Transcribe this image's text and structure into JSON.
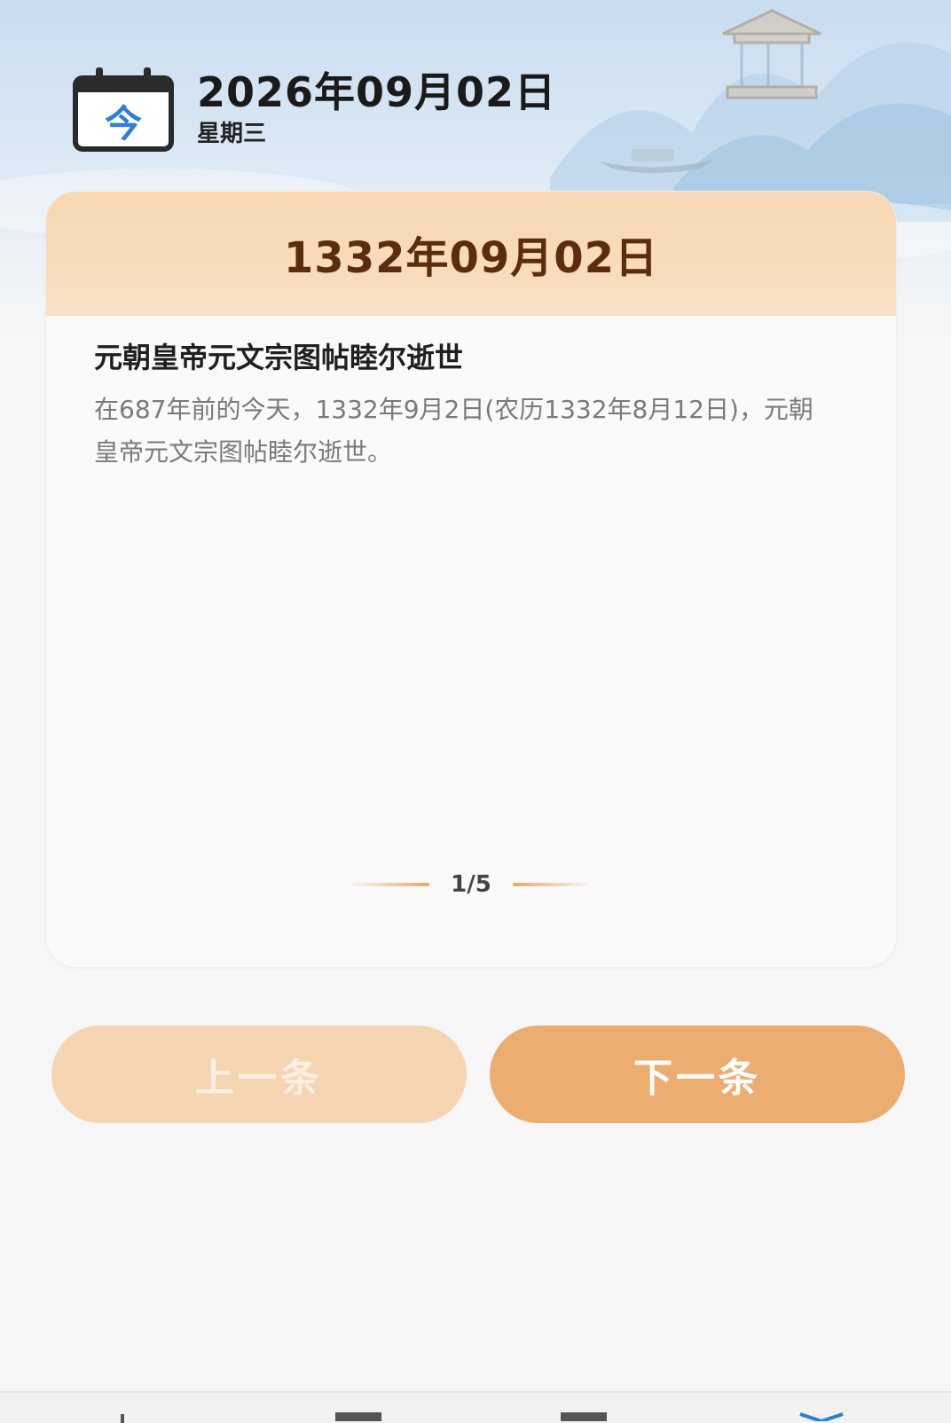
{
  "header": {
    "calendar_badge": "今",
    "today_date": "2026年09月02日",
    "weekday": "星期三"
  },
  "card": {
    "history_date": "1332年09月02日",
    "event_title": "元朝皇帝元文宗图帖睦尔逝世",
    "event_description": "在687年前的今天，1332年9月2日(农历1332年8月12日)，元朝皇帝元文宗图帖睦尔逝世。",
    "pager": "1/5"
  },
  "buttons": {
    "prev_label": "上一条",
    "next_label": "下一条"
  },
  "colors": {
    "card_header": "#f9dcbd",
    "title_brown": "#5a2d0c",
    "prev_button": "#f6d5b3",
    "next_button": "#ecad70",
    "calendar_blue": "#2b7fd4",
    "nav_active": "#2b7fd4"
  },
  "icons": {
    "calendar": "calendar-today-icon",
    "nav": [
      "nav-home-icon",
      "nav-calendar-icon",
      "nav-list-icon",
      "nav-history-icon"
    ]
  }
}
